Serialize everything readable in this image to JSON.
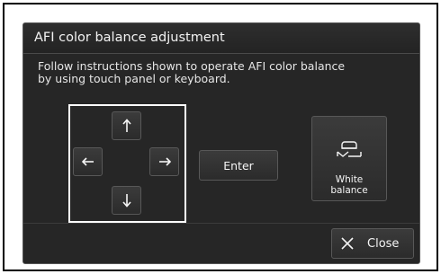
{
  "dialog": {
    "title": "AFI color balance adjustment",
    "instructions": "Follow instructions shown to operate AFI color balance\nby using touch panel or keyboard."
  },
  "arrows": [
    {
      "name": "up",
      "icon": "arrow-up-icon"
    },
    {
      "name": "left",
      "icon": "arrow-left-icon"
    },
    {
      "name": "right",
      "icon": "arrow-right-icon"
    },
    {
      "name": "down",
      "icon": "arrow-down-icon"
    }
  ],
  "enter_label": "Enter",
  "white_balance": {
    "label": "White\nbalance",
    "icon": "white-balance-icon"
  },
  "close": {
    "label": "Close",
    "icon": "close-icon"
  },
  "colors": {
    "dialog_bg": "#262626",
    "button_bg": "#333333",
    "text": "#f2f2f2",
    "highlight_frame": "#ffffff"
  }
}
